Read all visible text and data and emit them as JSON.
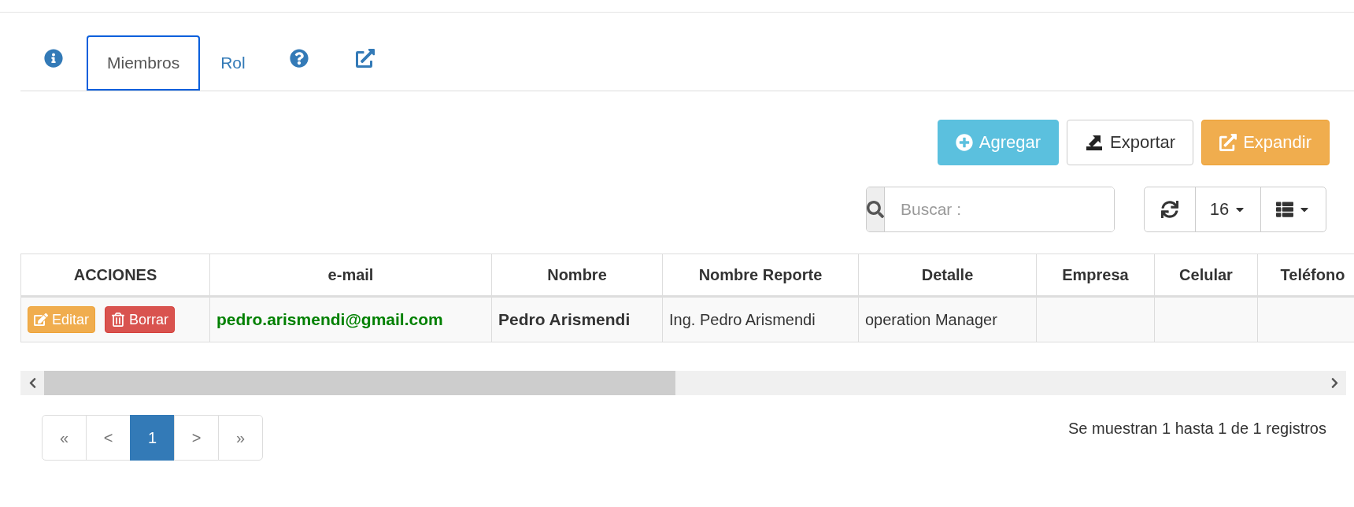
{
  "tabs": [
    {
      "kind": "info",
      "selected": false
    },
    {
      "kind": "text",
      "label": "Miembros",
      "selected": true
    },
    {
      "kind": "text",
      "label": "Rol",
      "selected": false
    },
    {
      "kind": "help",
      "selected": false
    },
    {
      "kind": "external",
      "selected": false
    }
  ],
  "actions": [
    {
      "kind": "add",
      "label": "Agregar"
    },
    {
      "kind": "export",
      "label": "Exportar"
    },
    {
      "kind": "expand",
      "label": "Expandir"
    }
  ],
  "search": {
    "placeholder": "Buscar :"
  },
  "page_size": "16",
  "table": {
    "columns": [
      "ACCIONES",
      "e-mail",
      "Nombre",
      "Nombre Reporte",
      "Detalle",
      "Empresa",
      "Celular",
      "Teléfono"
    ],
    "rows": [
      {
        "buttons": [
          {
            "kind": "edit",
            "label": "Editar"
          },
          {
            "kind": "delete",
            "label": "Borrar"
          }
        ],
        "email": "pedro.arismendi@gmail.com",
        "nombre": "Pedro Arismendi",
        "nombre_reporte": "Ing. Pedro Arismendi",
        "detalle": "operation Manager"
      }
    ]
  },
  "pagination": [
    {
      "label": "«",
      "selected": false
    },
    {
      "label": "<",
      "selected": false
    },
    {
      "label": "1",
      "selected": true
    },
    {
      "label": ">",
      "selected": false
    },
    {
      "label": "»",
      "selected": false
    }
  ],
  "summary": "Se muestran 1 hasta 1 de 1 registros"
}
